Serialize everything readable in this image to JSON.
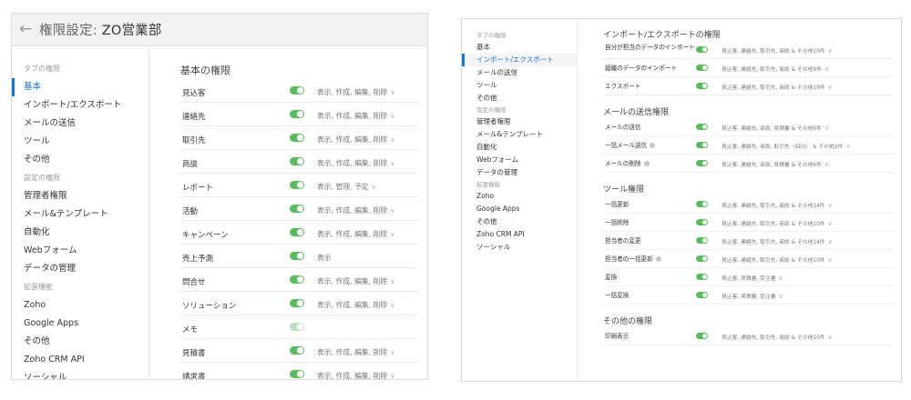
{
  "left": {
    "header": {
      "label": "権限設定:",
      "profile": "ZO営業部"
    },
    "sidebar": [
      {
        "type": "group",
        "label": "タブの権限"
      },
      {
        "type": "item",
        "label": "基本",
        "active": true
      },
      {
        "type": "item",
        "label": "インポート/エクスポート"
      },
      {
        "type": "item",
        "label": "メールの送信"
      },
      {
        "type": "item",
        "label": "ツール"
      },
      {
        "type": "item",
        "label": "その他"
      },
      {
        "type": "group",
        "label": "設定の権限"
      },
      {
        "type": "item",
        "label": "管理者権限"
      },
      {
        "type": "item",
        "label": "メール&テンプレート"
      },
      {
        "type": "item",
        "label": "自動化"
      },
      {
        "type": "item",
        "label": "Webフォーム"
      },
      {
        "type": "item",
        "label": "データの管理"
      },
      {
        "type": "group",
        "label": "拡張機能"
      },
      {
        "type": "item",
        "label": "Zoho"
      },
      {
        "type": "item",
        "label": "Google Apps"
      },
      {
        "type": "item",
        "label": "その他"
      },
      {
        "type": "item",
        "label": "Zoho CRM API"
      },
      {
        "type": "item",
        "label": "ソーシャル"
      }
    ],
    "section_title": "基本の権限",
    "rows": [
      {
        "name": "見込客",
        "value": "表示, 作成, 編集, 削除",
        "chevron": true
      },
      {
        "name": "連絡先",
        "value": "表示, 作成, 編集, 削除",
        "chevron": true
      },
      {
        "name": "取引先",
        "value": "表示, 作成, 編集, 削除",
        "chevron": true
      },
      {
        "name": "商談",
        "value": "表示, 作成, 編集, 削除",
        "chevron": true
      },
      {
        "name": "レポート",
        "value": "表示, 管理, 予定",
        "chevron": true
      },
      {
        "name": "活動",
        "value": "表示, 作成, 編集, 削除",
        "chevron": true
      },
      {
        "name": "キャンペーン",
        "value": "表示, 作成, 編集, 削除",
        "chevron": true
      },
      {
        "name": "売上予測",
        "value": "表示",
        "chevron": false
      },
      {
        "name": "問合せ",
        "value": "表示, 作成, 編集, 削除",
        "chevron": true
      },
      {
        "name": "ソリューション",
        "value": "表示, 作成, 編集, 削除",
        "chevron": true
      },
      {
        "name": "メモ",
        "value": "",
        "chevron": false,
        "disabled": true
      },
      {
        "name": "見積書",
        "value": "表示, 作成, 編集, 削除",
        "chevron": true
      },
      {
        "name": "請求書",
        "value": "表示, 作成, 編集, 削除",
        "chevron": true
      }
    ]
  },
  "right": {
    "sidebar": [
      {
        "type": "group",
        "label": "タブの権限"
      },
      {
        "type": "item",
        "label": "基本"
      },
      {
        "type": "item",
        "label": "インポート/エクスポート",
        "active": true
      },
      {
        "type": "item",
        "label": "メールの送信"
      },
      {
        "type": "item",
        "label": "ツール"
      },
      {
        "type": "item",
        "label": "その他"
      },
      {
        "type": "group",
        "label": "設定の権限"
      },
      {
        "type": "item",
        "label": "管理者権限"
      },
      {
        "type": "item",
        "label": "メール&テンプレート"
      },
      {
        "type": "item",
        "label": "自動化"
      },
      {
        "type": "item",
        "label": "Webフォーム"
      },
      {
        "type": "item",
        "label": "データの管理"
      },
      {
        "type": "group",
        "label": "拡張機能"
      },
      {
        "type": "item",
        "label": "Zoho"
      },
      {
        "type": "item",
        "label": "Google Apps"
      },
      {
        "type": "item",
        "label": "その他"
      },
      {
        "type": "item",
        "label": "Zoho CRM API"
      },
      {
        "type": "item",
        "label": "ソーシャル"
      }
    ],
    "sections": [
      {
        "title": "インポート/エクスポートの権限",
        "rows": [
          {
            "name": "自分が担当のデータのインポート",
            "value": "見込客, 連絡先, 取引先, 商談 & その他10件",
            "multiline": true
          },
          {
            "name": "組織のデータのインポート",
            "value": "見込客, 連絡先, 取引先, 商談 & その他9件"
          },
          {
            "name": "エクスポート",
            "value": "見込客, 連絡先, 取引先, 商談 & その他19件"
          }
        ]
      },
      {
        "title": "メールの送信権限",
        "rows": [
          {
            "name": "メールの送信",
            "value": "見込客, 連絡先, 商談, 見積書 & その他6件"
          },
          {
            "name": "一括メール送信",
            "info": true,
            "value": "見込客, 連絡先, 商談, 取引先（SEO） & その他2件"
          },
          {
            "name": "メールの削除",
            "info": true,
            "value": "見込客, 連絡先, 商談, 見積書 & その他6件"
          }
        ]
      },
      {
        "title": "ツール権限",
        "rows": [
          {
            "name": "一括更新",
            "value": "見込客, 連絡先, 取引先, 商談 & その他14件"
          },
          {
            "name": "一括削除",
            "value": "見込客, 連絡先, 取引先, 商談 & その他10件"
          },
          {
            "name": "担当者の変更",
            "value": "見込客, 連絡先, 取引先, 商談 & その他14件"
          },
          {
            "name": "担当者の一括更新",
            "info": true,
            "value": "見込客, 連絡先, 取引先, 商談 & その他10件"
          },
          {
            "name": "変換",
            "value": "見込客, 見積書, 受注書"
          },
          {
            "name": "一括変換",
            "value": "見込客, 見積書, 受注書"
          }
        ]
      },
      {
        "title": "その他の権限",
        "rows": [
          {
            "name": "印刷表示",
            "value": "見込客, 連絡先, 取引先, 商談 & その他15件"
          }
        ]
      }
    ]
  }
}
